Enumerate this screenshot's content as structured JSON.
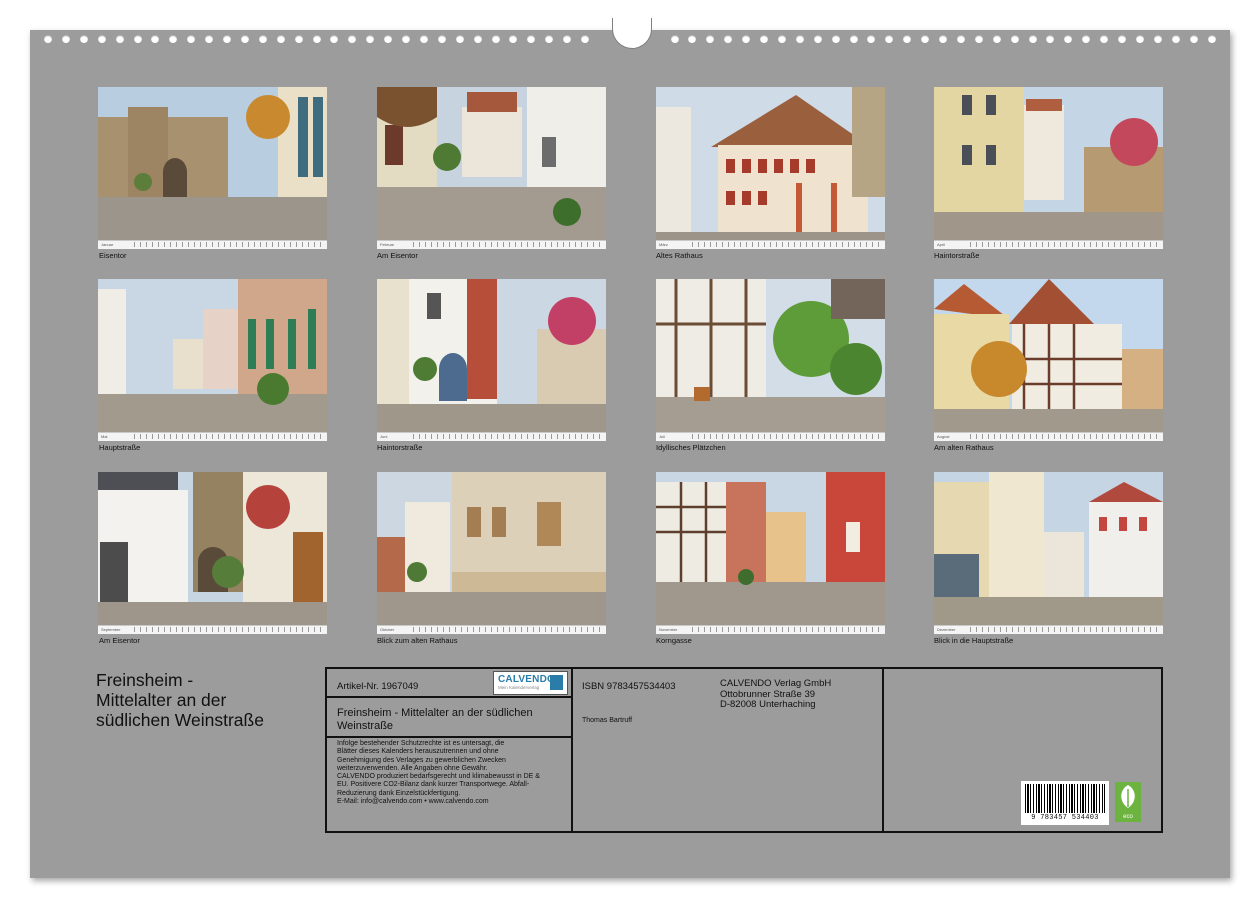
{
  "calendar": {
    "title_lines": [
      "Freinsheim -",
      "Mittelalter an der",
      "südlichen Weinstraße"
    ],
    "photos": [
      {
        "month": "Januar",
        "caption": "Eisentor"
      },
      {
        "month": "Februar",
        "caption": "Am Eisentor"
      },
      {
        "month": "März",
        "caption": "Altes Rathaus"
      },
      {
        "month": "April",
        "caption": "Haintorstraße"
      },
      {
        "month": "Mai",
        "caption": "Hauptstraße"
      },
      {
        "month": "Juni",
        "caption": "Haintorstraße"
      },
      {
        "month": "Juli",
        "caption": "Idyllisches Plätzchen"
      },
      {
        "month": "August",
        "caption": "Am alten Rathaus"
      },
      {
        "month": "September",
        "caption": "Am Eisentor"
      },
      {
        "month": "Oktober",
        "caption": "Blick zum alten Rathaus"
      },
      {
        "month": "November",
        "caption": "Korngasse"
      },
      {
        "month": "Dezember",
        "caption": "Blick in die Hauptstraße"
      }
    ]
  },
  "info": {
    "article": "Artikel-Nr. 1967049",
    "logo": {
      "name": "CALVENDO",
      "tagline": "Mein Kalenderverlag"
    },
    "isbn": "ISBN 9783457534403",
    "publisher_lines": [
      "CALVENDO Verlag GmbH",
      "Ottobrunner Straße 39",
      "D-82008 Unterhaching"
    ],
    "product_title_lines": [
      "Freinsheim - Mittelalter an der südlichen",
      "Weinstraße"
    ],
    "author": "Thomas Bartruff",
    "legal_lines": [
      "Infolge bestehender Schutzrechte ist es untersagt, die",
      "Blätter dieses Kalenders herauszutrennen und ohne",
      "Genehmigung des Verlages zu gewerblichen Zwecken",
      "weiterzuverwenden. Alle Angaben ohne Gewähr.",
      "CALVENDO produziert bedarfsgerecht und klimabewusst in DE &",
      "EU. Positivere CO2-Bilanz dank kurzer Transportwege. Abfall-",
      "Reduzierung dank Einzelstückfertigung.",
      "E-Mail: info@calvendo.com • www.calvendo.com"
    ],
    "barcode_number": "9 783457 534403",
    "eco_label": "eco"
  },
  "colors": {
    "sheet": "#9c9c9c",
    "border": "#111111",
    "calvendo_blue": "#2a7da8",
    "eco_green": "#6cb43f"
  }
}
